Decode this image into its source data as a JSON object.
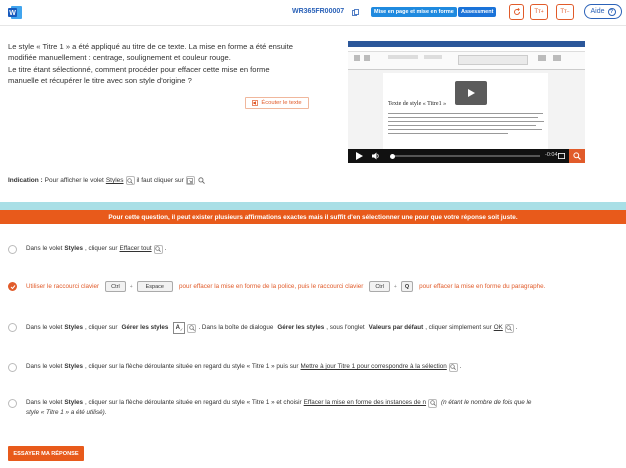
{
  "header": {
    "question_id": "WR365FR00007",
    "tags": [
      "Mise en page et mise en forme",
      "Assessment"
    ],
    "help_label": "Aide",
    "help_glyph": "?",
    "font_btn_glyph": "Tт"
  },
  "question": {
    "lines": [
      "Le style « Titre 1 » a été appliqué au titre de ce texte. La mise en forme a été ensuite",
      "modifiée manuellement : centrage, soulignement et couleur rouge.",
      "Le titre étant sélectionné, comment procéder pour effacer cette mise en forme",
      "manuelle et récupérer le titre avec son style d'origine ?"
    ],
    "listen_label": "Écouter le texte"
  },
  "video": {
    "doc_title": "Texte de style « Titre1 »",
    "time": "-0:04"
  },
  "indication": {
    "label": "Indication :",
    "text_before": "Pour afficher le volet",
    "link": "Styles",
    "text_after": "il faut cliquer sur"
  },
  "banner": {
    "text": "Pour cette question, il peut exister plusieurs affirmations exactes mais il suffit d'en sélectionner une pour que votre réponse soit juste."
  },
  "options": {
    "o1": {
      "pre": "Dans le volet",
      "styles": "Styles",
      "mid": ", cliquer sur",
      "link": "Effacer tout"
    },
    "o2": {
      "pre": "Utiliser le raccourci clavier",
      "key1": "Ctrl",
      "key2": "Espace",
      "mid": "pour effacer la mise en forme de la police, puis le raccourci clavier",
      "key3": "Ctrl",
      "key4": "Q",
      "post": "pour effacer la mise en forme du paragraphe."
    },
    "o3": {
      "pre": "Dans le volet",
      "styles": "Styles",
      "mid": ", cliquer sur",
      "btn": "Gérer les styles",
      "mid2": ". Dans la boîte de dialogue",
      "dlg": "Gérer les styles",
      "mid3": ", sous l'onglet",
      "tab": "Valeurs par défaut",
      "mid4": ", cliquer simplement sur",
      "ok": "OK"
    },
    "o4": {
      "pre": "Dans le volet",
      "styles": "Styles",
      "mid": ", cliquer sur la flèche déroulante située en regard du style « Titre 1 » puis sur",
      "link": "Mettre à jour Titre 1 pour correspondre à la sélection"
    },
    "o5": {
      "pre": "Dans le volet",
      "styles": "Styles",
      "mid": ", cliquer sur la flèche déroulante située en regard du style « Titre 1 » et choisir",
      "link": "Effacer la mise en forme des instances de n",
      "note1": "(n étant le nombre de fois que le",
      "note2": "style « Titre 1 » a été utilisé)."
    }
  },
  "submit_label": "ESSAYER MA RÉPONSE"
}
